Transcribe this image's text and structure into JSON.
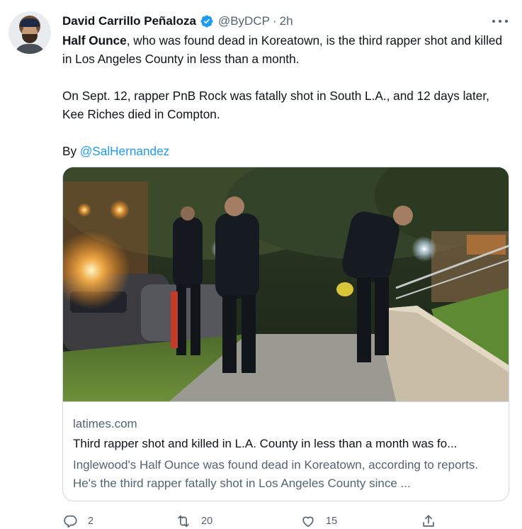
{
  "author": {
    "name": "David Carrillo Peñaloza",
    "handle": "@ByDCP",
    "separator": "·",
    "time": "2h",
    "verified": true
  },
  "tweet": {
    "lead_bold": "Half Ounce",
    "lead_rest": ", who was found dead in Koreatown, is the third rapper shot and killed in Los Angeles County in less than a month.",
    "paragraph2": "On Sept. 12, rapper PnB Rock was fatally shot in South L.A., and 12 days later, Kee Riches died in Compton.",
    "byline_prefix": "By ",
    "byline_mention": "@SalHernandez"
  },
  "card": {
    "domain": "latimes.com",
    "title": "Third rapper shot and killed in L.A. County in less than a month was fo...",
    "description": "Inglewood's Half Ounce was found dead in Koreatown, according to reports. He's the third rapper fatally shot in Los Angeles County since ..."
  },
  "actions": {
    "reply_count": "2",
    "retweet_count": "20",
    "like_count": "15"
  },
  "colors": {
    "accent": "#1d9bf0",
    "secondary_text": "#536471",
    "border": "#cfd9de"
  },
  "icons": {
    "verified": "verified-badge-icon",
    "more": "more-dots-icon",
    "reply": "reply-icon",
    "retweet": "retweet-icon",
    "like": "heart-icon",
    "share": "share-icon"
  }
}
